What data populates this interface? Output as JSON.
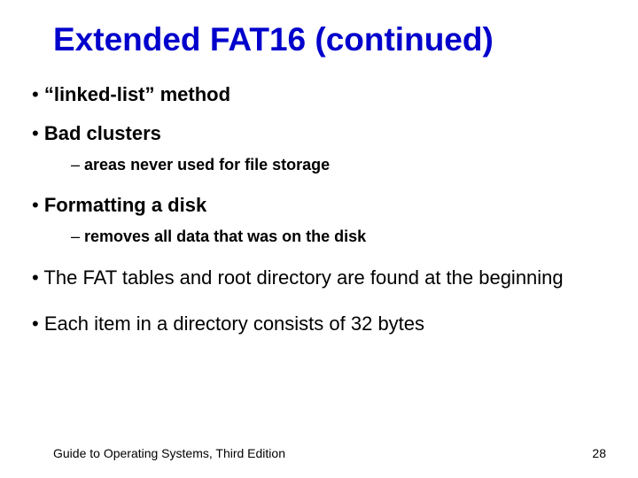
{
  "title": "Extended FAT16 (continued)",
  "bullets": {
    "b1": "“linked-list” method",
    "b2": "Bad clusters",
    "b2a": "areas never used for file storage",
    "b3": "Formatting a disk",
    "b3a": "removes all data that was on the disk",
    "b4": "The FAT tables and root directory are found at the beginning",
    "b5": "Each item in a directory consists of 32 bytes"
  },
  "footer": {
    "source": "Guide to Operating Systems, Third Edition",
    "page": "28"
  }
}
